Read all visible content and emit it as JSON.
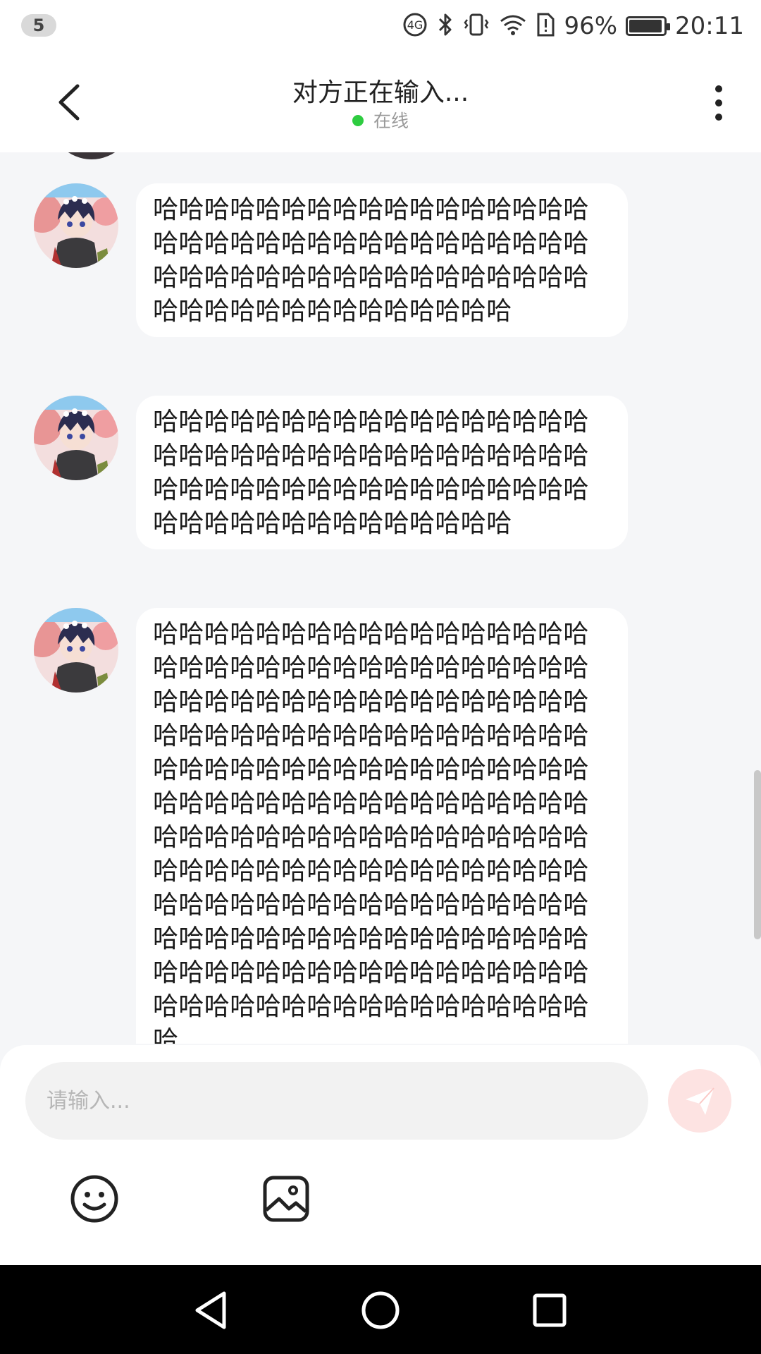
{
  "status_bar": {
    "notification_count": "5",
    "battery_percent": "96%",
    "time": "20:11",
    "icons": [
      "data-saver-icon",
      "bluetooth-icon",
      "vibrate-icon",
      "wifi-icon",
      "sim-alert-icon",
      "battery-icon"
    ]
  },
  "header": {
    "title": "对方正在输入...",
    "status": "在线",
    "status_color": "#2ecc40"
  },
  "messages": [
    {
      "sender": "other",
      "text": "哈哈哈哈哈哈哈哈哈哈哈哈哈哈哈哈哈哈哈哈哈哈哈哈哈哈哈哈哈哈哈哈哈哈哈哈哈哈哈哈哈哈哈哈哈哈哈哈哈哈哈哈哈哈哈哈哈哈哈哈哈哈哈哈哈"
    },
    {
      "sender": "other",
      "text": "哈哈哈哈哈哈哈哈哈哈哈哈哈哈哈哈哈哈哈哈哈哈哈哈哈哈哈哈哈哈哈哈哈哈哈哈哈哈哈哈哈哈哈哈哈哈哈哈哈哈哈哈哈哈哈哈哈哈哈哈哈哈哈哈哈"
    },
    {
      "sender": "other",
      "text": "哈哈哈哈哈哈哈哈哈哈哈哈哈哈哈哈哈哈哈哈哈哈哈哈哈哈哈哈哈哈哈哈哈哈哈哈哈哈哈哈哈哈哈哈哈哈哈哈哈哈哈哈哈哈哈哈哈哈哈哈哈哈哈哈哈哈哈哈哈哈哈哈哈哈哈哈哈哈哈哈哈哈哈哈哈哈哈哈哈哈哈哈哈哈哈哈哈哈哈哈哈哈哈哈哈哈哈哈哈哈哈哈哈哈哈哈哈哈哈哈哈哈哈哈哈哈哈哈哈哈哈哈哈哈哈哈哈哈哈哈哈哈哈哈哈哈哈哈哈哈哈哈哈哈哈哈哈哈哈哈哈哈哈哈哈哈哈哈哈哈哈哈哈哈哈哈哈哈哈哈哈哈哈哈哈哈哈哈哈哈哈哈哈哈哈哈哈哈哈哈哈哈哈哈哈"
    }
  ],
  "composer": {
    "placeholder": "请输入...",
    "value": "",
    "send_color": "#fde3e2",
    "tools": [
      "emoji-icon",
      "image-icon"
    ]
  },
  "nav": {
    "buttons": [
      "back-triangle-icon",
      "home-circle-icon",
      "recents-square-icon"
    ]
  }
}
